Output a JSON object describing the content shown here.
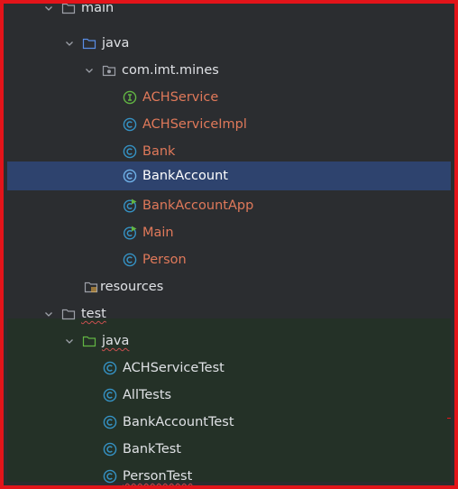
{
  "tree": {
    "top_partial": {
      "label": "main",
      "icon": "folder-icon"
    },
    "items": [
      {
        "label": "java",
        "icon": "folder-icon",
        "kind": "folder",
        "expanded": true
      },
      {
        "label": "com.imt.mines",
        "icon": "package-icon",
        "kind": "package",
        "expanded": true
      },
      {
        "label": "ACHService",
        "icon": "interface-icon",
        "kind": "interface"
      },
      {
        "label": "ACHServiceImpl",
        "icon": "class-icon",
        "kind": "class"
      },
      {
        "label": "Bank",
        "icon": "class-icon",
        "kind": "class"
      },
      {
        "label": "BankAccount",
        "icon": "class-icon",
        "kind": "class",
        "selected": true
      },
      {
        "label": "BankAccountApp",
        "icon": "runnable-class-icon",
        "kind": "class"
      },
      {
        "label": "Main",
        "icon": "runnable-class-icon",
        "kind": "class"
      },
      {
        "label": "Person",
        "icon": "class-icon",
        "kind": "class"
      },
      {
        "label": "resources",
        "icon": "resources-folder-icon",
        "kind": "folder"
      },
      {
        "label": "test",
        "icon": "folder-icon",
        "kind": "folder",
        "expanded": true
      },
      {
        "label": "java",
        "icon": "test-folder-icon",
        "kind": "folder",
        "expanded": true
      },
      {
        "label": "ACHServiceTest",
        "icon": "class-icon",
        "kind": "test-class"
      },
      {
        "label": "AllTests",
        "icon": "class-icon",
        "kind": "test-class"
      },
      {
        "label": "BankAccountTest",
        "icon": "class-icon",
        "kind": "test-class"
      },
      {
        "label": "BankTest",
        "icon": "class-icon",
        "kind": "test-class"
      },
      {
        "label": "PersonTest",
        "icon": "class-icon",
        "kind": "test-class"
      }
    ]
  },
  "colors": {
    "background": "#2b2d30",
    "selection": "#2e436e",
    "test_band": "#243127",
    "frame_border": "#e3141a",
    "class_text": "#e0795a",
    "default_text": "#dfe1e5",
    "class_icon": "#3592c4",
    "interface_icon": "#62b543",
    "runnable_badge": "#62b543"
  }
}
